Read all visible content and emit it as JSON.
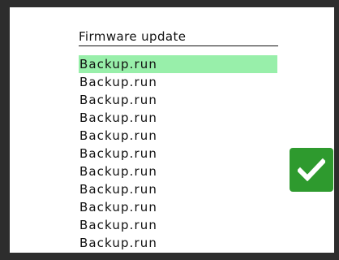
{
  "header": {
    "title": "Firmware update"
  },
  "files": [
    {
      "label": "Backup.run",
      "selected": true
    },
    {
      "label": "Backup.run",
      "selected": false
    },
    {
      "label": "Backup.run",
      "selected": false
    },
    {
      "label": "Backup.run",
      "selected": false
    },
    {
      "label": "Backup.run",
      "selected": false
    },
    {
      "label": "Backup.run",
      "selected": false
    },
    {
      "label": "Backup.run",
      "selected": false
    },
    {
      "label": "Backup.run",
      "selected": false
    },
    {
      "label": "Backup.run",
      "selected": false
    },
    {
      "label": "Backup.run",
      "selected": false
    },
    {
      "label": "Backup.run",
      "selected": false
    }
  ],
  "confirm": {
    "icon": "checkmark-icon",
    "color": "#2e9a2e"
  },
  "colors": {
    "selection": "#98efaa",
    "frame": "#2d2d2d"
  }
}
